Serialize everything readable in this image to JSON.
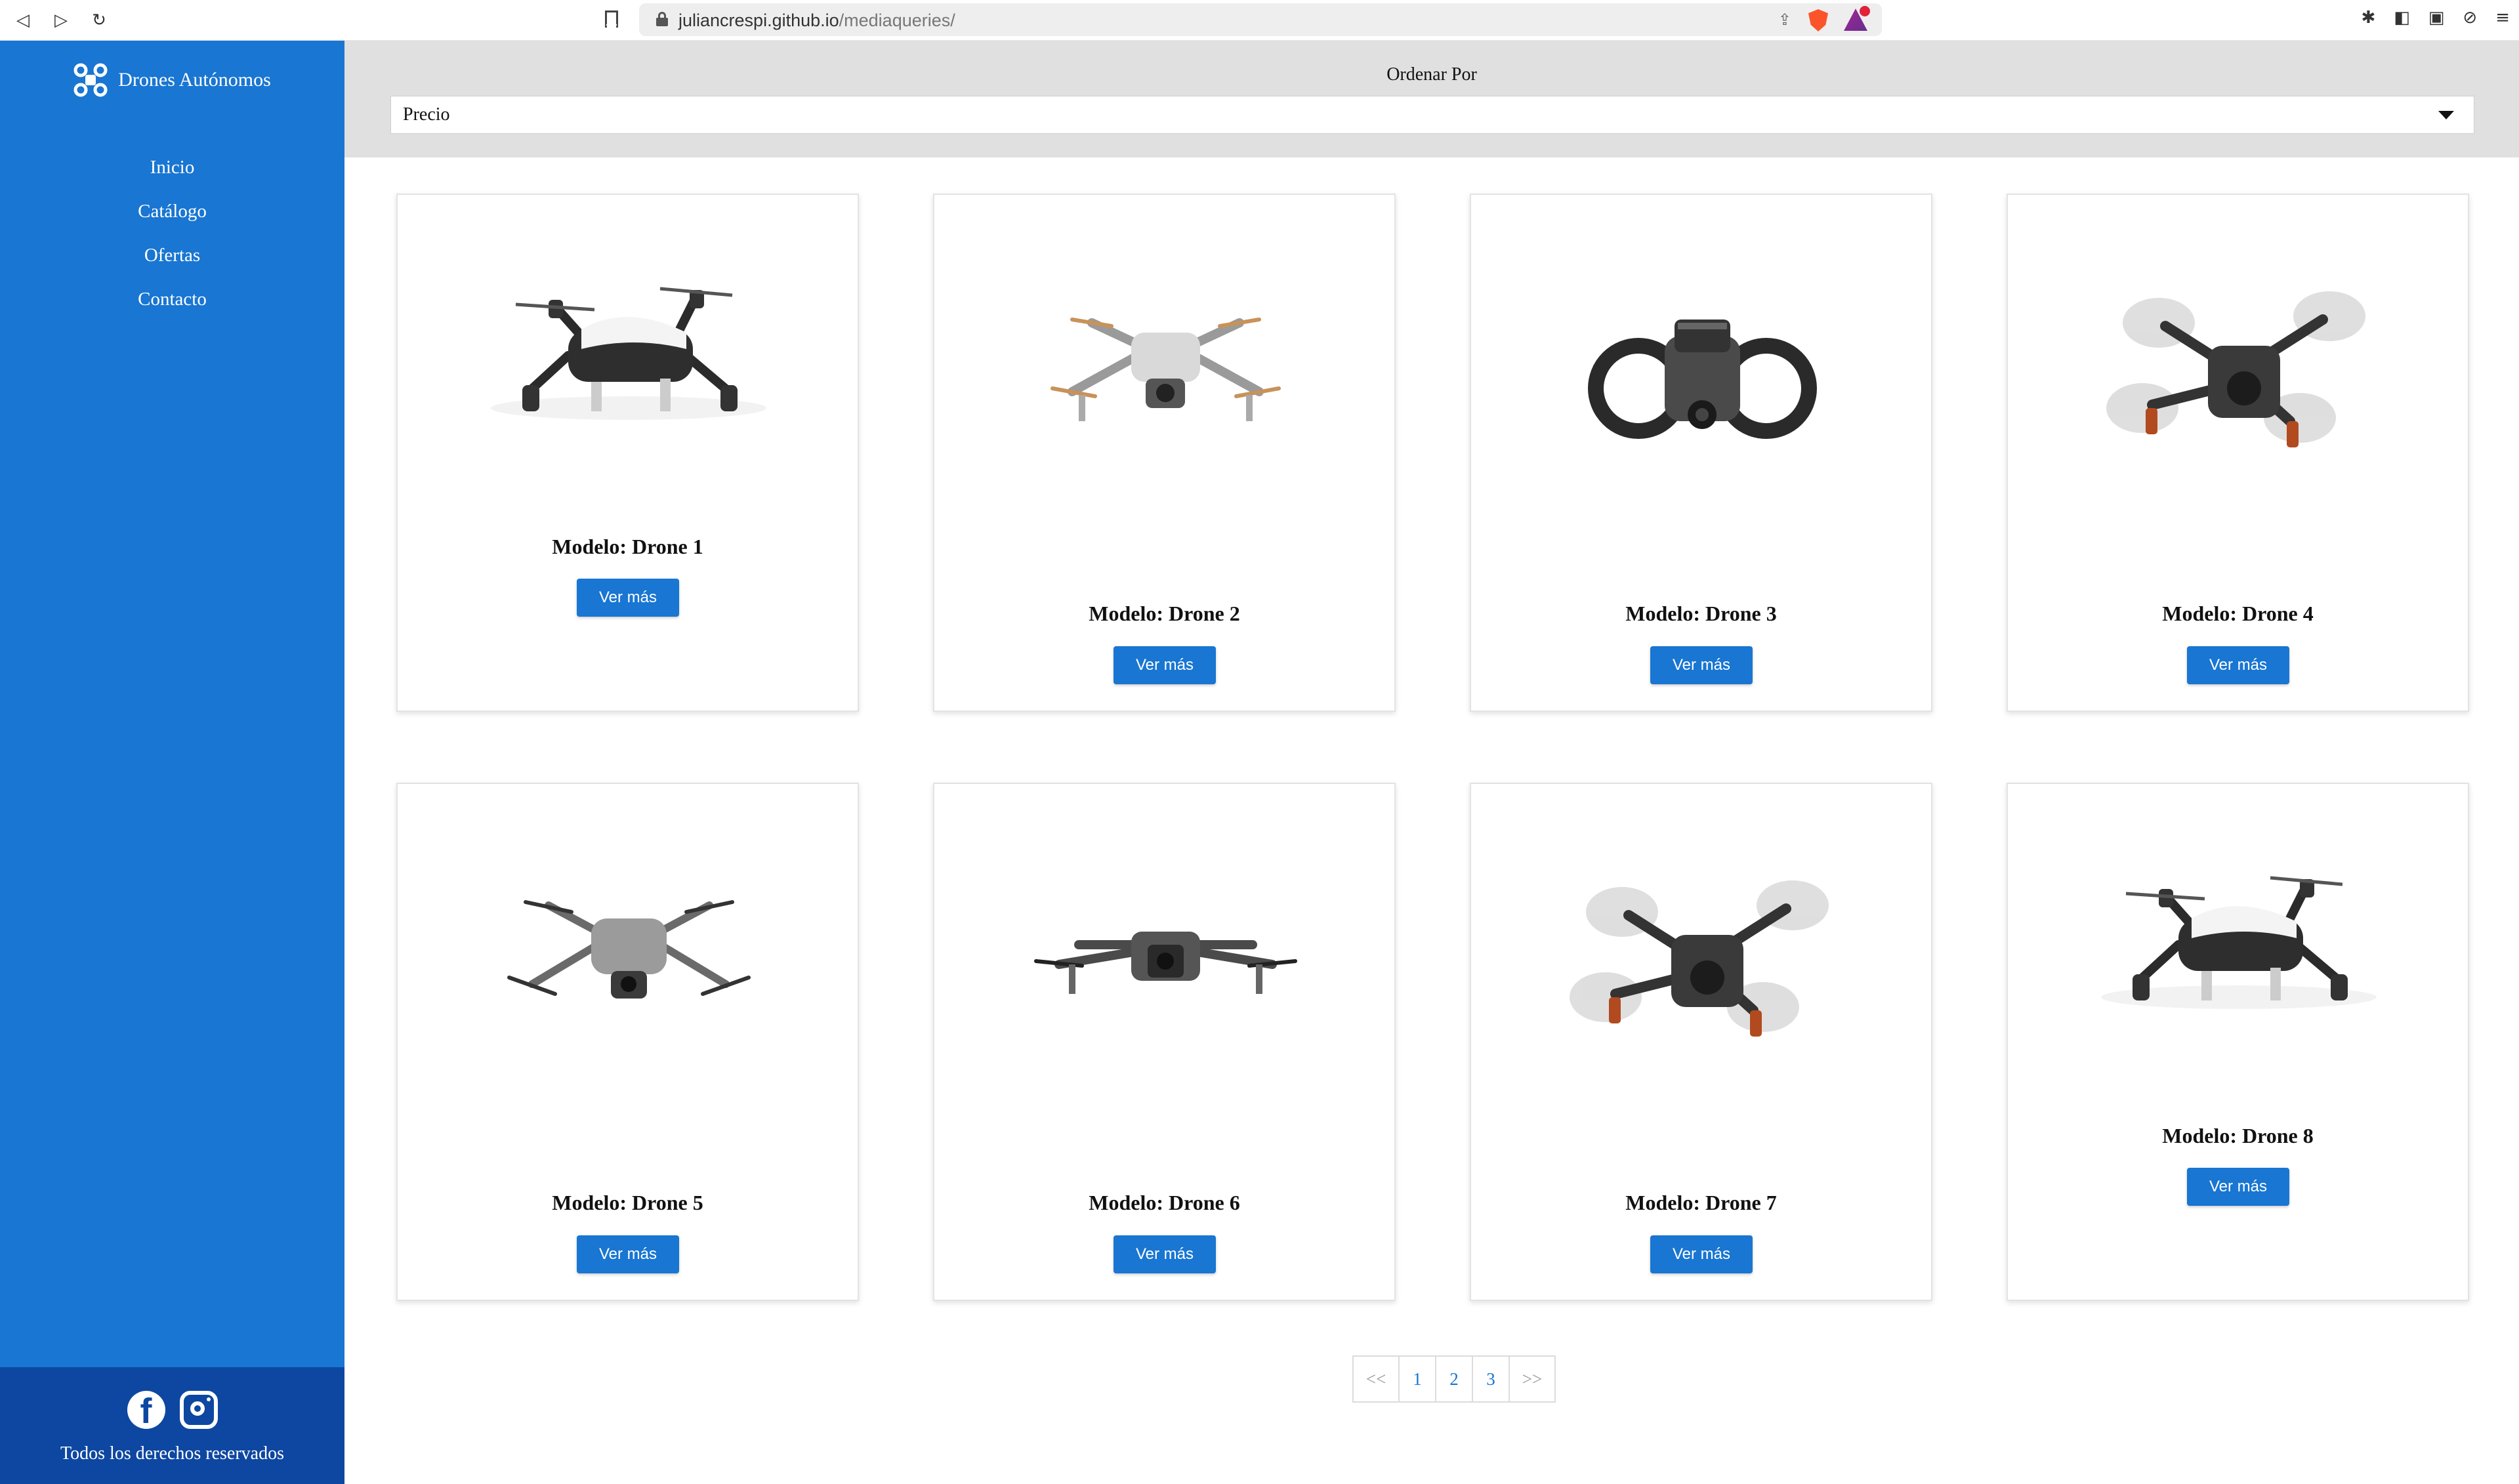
{
  "browser": {
    "url_domain": "juliancrespi.github.io",
    "url_path": "/mediaqueries/"
  },
  "sidebar": {
    "brand": "Drones Autónomos",
    "nav": [
      "Inicio",
      "Catálogo",
      "Ofertas",
      "Contacto"
    ],
    "footer_text": "Todos los derechos reservados"
  },
  "sort": {
    "label": "Ordenar Por",
    "selected": "Precio"
  },
  "products": [
    {
      "title": "Modelo: Drone 1",
      "button": "Ver más",
      "style": "tello"
    },
    {
      "title": "Modelo: Drone 2",
      "button": "Ver más",
      "style": "air"
    },
    {
      "title": "Modelo: Drone 3",
      "button": "Ver más",
      "style": "avata"
    },
    {
      "title": "Modelo: Drone 4",
      "button": "Ver más",
      "style": "fpv"
    },
    {
      "title": "Modelo: Drone 5",
      "button": "Ver más",
      "style": "mini"
    },
    {
      "title": "Modelo: Drone 6",
      "button": "Ver más",
      "style": "mavic"
    },
    {
      "title": "Modelo: Drone 7",
      "button": "Ver más",
      "style": "fpv"
    },
    {
      "title": "Modelo: Drone 8",
      "button": "Ver más",
      "style": "tello"
    }
  ],
  "pagination": {
    "prev": "<<",
    "pages": [
      "1",
      "2",
      "3"
    ],
    "next": ">>"
  },
  "colors": {
    "primary": "#1976d2",
    "primary_dark": "#0d47a1",
    "panel": "#e0e0e0"
  }
}
